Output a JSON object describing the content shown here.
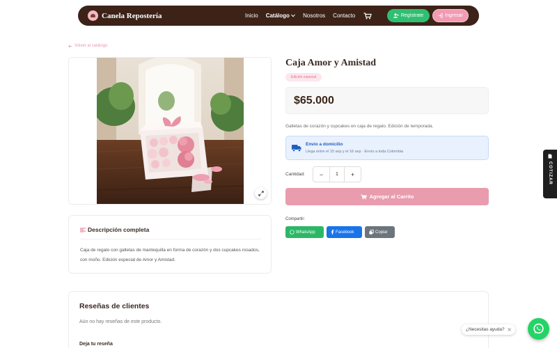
{
  "nav": {
    "brand": "Canela Repostería",
    "links": [
      "Inicio",
      "Catálogo",
      "Nosotros",
      "Contacto"
    ],
    "register": "Regístrate",
    "login": "Ingresar"
  },
  "back_link": "Volver al catálogo",
  "product": {
    "title": "Caja Amor y Amistad",
    "badge": "Edición especial",
    "price": "$65.000",
    "short_description": "Galletas de corazón y cupcakes en caja de regalo. Edición de temporada.",
    "shipping": {
      "title": "Envío a domicilio",
      "subtitle": "Llega entre el 15 sep y el 16 sep · Envío a toda Colombia"
    },
    "quantity_label": "Cantidad:",
    "quantity": "1",
    "qty_minus": "−",
    "qty_plus": "+",
    "add_to_cart": "Agregar al Carrito",
    "share_label": "Compartir:",
    "share": {
      "whatsapp": "WhatsApp",
      "facebook": "Facebook",
      "copy": "Copiar"
    }
  },
  "description": {
    "heading": "Descripción completa",
    "text": "Caja de regalo con galletas de mantequilla en forma de corazón y dos cupcakes rosados, con moño. Edición especial de Amor y Amistad."
  },
  "reviews": {
    "heading": "Reseñas de clientes",
    "empty": "Aún no hay reseñas de este producto.",
    "leave": "Deja tu reseña"
  },
  "side_tab": "COTIZAR",
  "help": "¿Necesitas ayuda?",
  "colors": {
    "nav_bg": "#3d2218",
    "accent_pink": "#e89cad",
    "green": "#2fbf71",
    "whatsapp": "#25d366"
  }
}
